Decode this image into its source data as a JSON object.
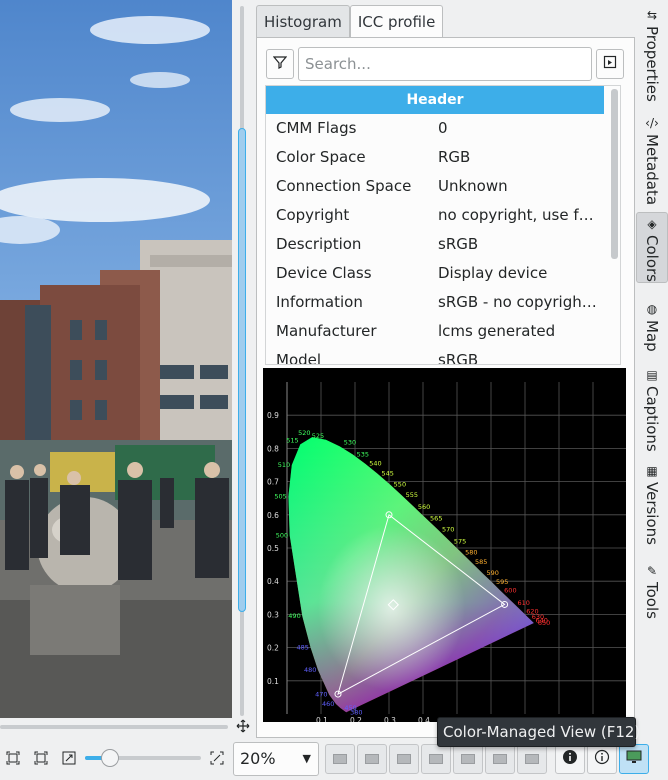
{
  "tabs": [
    {
      "label": "Histogram",
      "active": false
    },
    {
      "label": "ICC profile",
      "active": true
    }
  ],
  "search": {
    "placeholder": "Search...",
    "value": ""
  },
  "table": {
    "header": "Header",
    "rows": [
      {
        "key": "CMM Flags",
        "value": "0"
      },
      {
        "key": "Color Space",
        "value": "RGB"
      },
      {
        "key": "Connection Space",
        "value": "Unknown"
      },
      {
        "key": "Copyright",
        "value": "no copyright, use fre..."
      },
      {
        "key": "Description",
        "value": "sRGB"
      },
      {
        "key": "Device Class",
        "value": "Display device"
      },
      {
        "key": "Information",
        "value": "sRGB - no copyright..."
      },
      {
        "key": "Manufacturer",
        "value": "lcms generated"
      },
      {
        "key": "Model",
        "value": "sRGB"
      }
    ]
  },
  "cie": {
    "x_ticks": [
      "0.1",
      "0.2",
      "0.3",
      "0.4"
    ],
    "y_ticks": [
      "0.9",
      "0.8",
      "0.7",
      "0.6",
      "0.5",
      "0.4",
      "0.3",
      "0.2",
      "0.1"
    ],
    "wavelengths": [
      {
        "label": "520",
        "x": 0.074,
        "y": 0.834
      },
      {
        "label": "525",
        "x": 0.114,
        "y": 0.826
      },
      {
        "label": "530",
        "x": 0.155,
        "y": 0.806
      },
      {
        "label": "515",
        "x": 0.039,
        "y": 0.812
      },
      {
        "label": "535",
        "x": 0.193,
        "y": 0.782
      },
      {
        "label": "510",
        "x": 0.014,
        "y": 0.75
      },
      {
        "label": "540",
        "x": 0.23,
        "y": 0.754
      },
      {
        "label": "545",
        "x": 0.266,
        "y": 0.724
      },
      {
        "label": "550",
        "x": 0.302,
        "y": 0.692
      },
      {
        "label": "505",
        "x": 0.004,
        "y": 0.655
      },
      {
        "label": "555",
        "x": 0.337,
        "y": 0.659
      },
      {
        "label": "560",
        "x": 0.373,
        "y": 0.624
      },
      {
        "label": "565",
        "x": 0.409,
        "y": 0.589
      },
      {
        "label": "570",
        "x": 0.444,
        "y": 0.555
      },
      {
        "label": "500",
        "x": 0.008,
        "y": 0.538
      },
      {
        "label": "575",
        "x": 0.479,
        "y": 0.52
      },
      {
        "label": "580",
        "x": 0.512,
        "y": 0.487
      },
      {
        "label": "585",
        "x": 0.541,
        "y": 0.458
      },
      {
        "label": "590",
        "x": 0.575,
        "y": 0.424
      },
      {
        "label": "595",
        "x": 0.603,
        "y": 0.397
      },
      {
        "label": "600",
        "x": 0.627,
        "y": 0.372
      },
      {
        "label": "490",
        "x": 0.045,
        "y": 0.295
      },
      {
        "label": "610",
        "x": 0.666,
        "y": 0.334
      },
      {
        "label": "620",
        "x": 0.692,
        "y": 0.308
      },
      {
        "label": "630",
        "x": 0.708,
        "y": 0.292
      },
      {
        "label": "640",
        "x": 0.719,
        "y": 0.281
      },
      {
        "label": "650",
        "x": 0.726,
        "y": 0.274
      },
      {
        "label": "485",
        "x": 0.069,
        "y": 0.201
      },
      {
        "label": "480",
        "x": 0.091,
        "y": 0.133
      },
      {
        "label": "470",
        "x": 0.124,
        "y": 0.058
      },
      {
        "label": "460",
        "x": 0.144,
        "y": 0.03
      },
      {
        "label": "450",
        "x": 0.157,
        "y": 0.018
      },
      {
        "label": "380",
        "x": 0.174,
        "y": 0.005
      }
    ],
    "gamut": {
      "red": [
        0.64,
        0.33
      ],
      "green": [
        0.3,
        0.6
      ],
      "blue": [
        0.15,
        0.06
      ],
      "white": [
        0.3127,
        0.329
      ]
    }
  },
  "sidebar": [
    {
      "label": "Properties",
      "icon": "sliders-icon",
      "active": false
    },
    {
      "label": "Metadata",
      "icon": "code-icon",
      "active": false
    },
    {
      "label": "Colors",
      "icon": "paint-bucket-icon",
      "active": true
    },
    {
      "label": "Map",
      "icon": "globe-icon",
      "active": false
    },
    {
      "label": "Captions",
      "icon": "document-icon",
      "active": false
    },
    {
      "label": "Versions",
      "icon": "versions-icon",
      "active": false
    },
    {
      "label": "Tools",
      "icon": "wrench-icon",
      "active": false
    }
  ],
  "toolbar": {
    "zoom_value": "20%",
    "zoom_level": 0.2,
    "tooltip": "Color-Managed View (F12)"
  },
  "colors": {
    "accent": "#3daee9",
    "panel_bg": "#fcfcfc",
    "window_bg": "#eff0f1"
  }
}
